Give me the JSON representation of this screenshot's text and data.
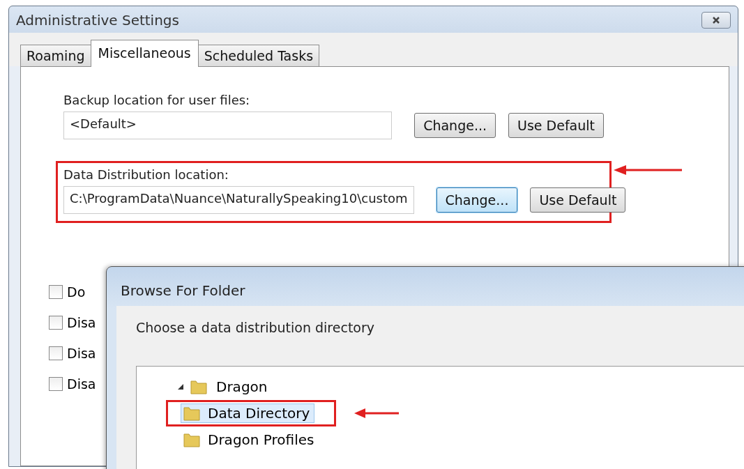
{
  "window": {
    "title": "Administrative Settings"
  },
  "tabs": [
    {
      "label": "Roaming",
      "selected": false
    },
    {
      "label": "Miscellaneous",
      "selected": true
    },
    {
      "label": "Scheduled Tasks",
      "selected": false
    }
  ],
  "locations": [
    {
      "label": "Backup location for user files:",
      "value": "<Default>",
      "highlighted": false,
      "buttons": [
        {
          "label": "Change...",
          "focused": false
        },
        {
          "label": "Use Default",
          "focused": false
        }
      ]
    },
    {
      "label": "Data Distribution location:",
      "value": "C:\\ProgramData\\Nuance\\NaturallySpeaking10\\custom",
      "highlighted": true,
      "buttons": [
        {
          "label": "Change...",
          "focused": true
        },
        {
          "label": "Use Default",
          "focused": false
        }
      ]
    }
  ],
  "checkboxes": [
    {
      "label": "Do",
      "checked": false
    },
    {
      "label": "Disa",
      "checked": false
    },
    {
      "label": "Disa",
      "checked": false
    },
    {
      "label": "Disa",
      "checked": false
    }
  ],
  "browse_dialog": {
    "title": "Browse For Folder",
    "prompt": "Choose a data distribution directory",
    "tree": [
      {
        "label": "Dragon",
        "expanded": true,
        "selected": false,
        "children": [
          {
            "label": "Data Directory",
            "selected": true,
            "highlighted": true
          },
          {
            "label": "Dragon Profiles",
            "selected": false,
            "highlighted": false
          }
        ]
      }
    ]
  }
}
